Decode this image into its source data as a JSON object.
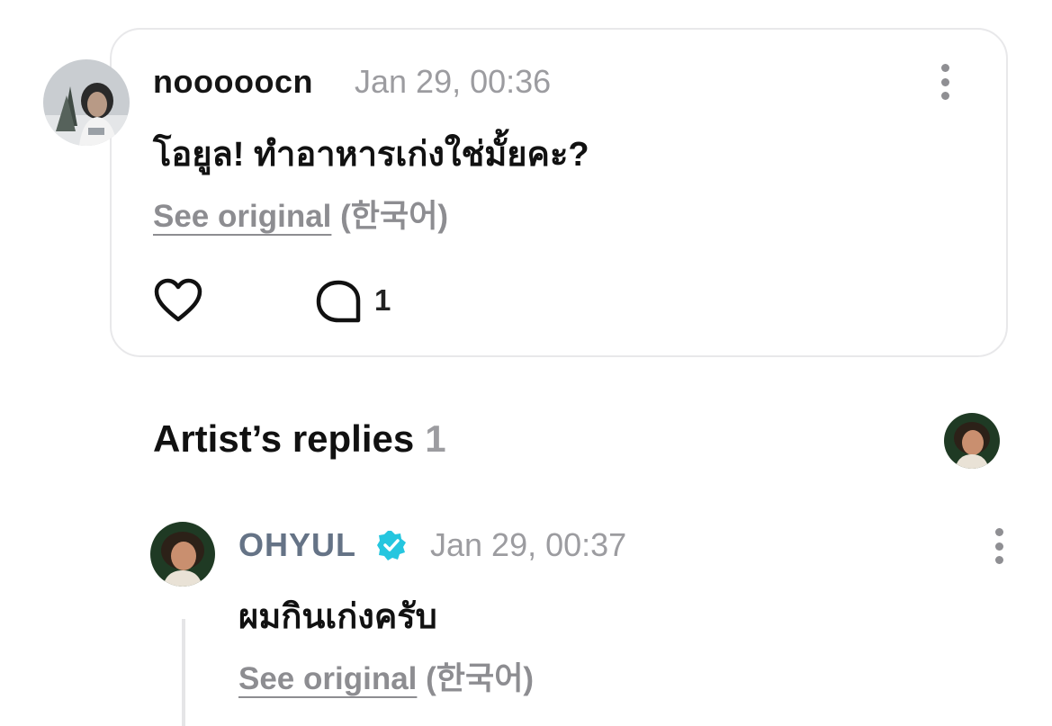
{
  "comment": {
    "username": "nooooocn",
    "timestamp": "Jan 29, 00:36",
    "text": "โอยูล! ทำอาหารเก่งใช่มั้ยคะ?",
    "see_original": "See original",
    "language": "(한국어)",
    "reply_count": "1"
  },
  "artist_replies": {
    "title": "Artist’s replies",
    "count": "1"
  },
  "reply": {
    "username": "OHYUL",
    "timestamp": "Jan 29, 00:37",
    "text": "ผมกินเก่งครับ",
    "see_original": "See original",
    "language": "(한국어)"
  },
  "colors": {
    "verified_badge": "#25c6df",
    "artist_name": "#657386",
    "muted_text": "#9c9ca0"
  },
  "icons": {
    "like": "heart-outline-icon",
    "comment": "speech-bubble-outline-icon",
    "more": "vertical-ellipsis-icon",
    "verified": "verified-badge-icon"
  }
}
